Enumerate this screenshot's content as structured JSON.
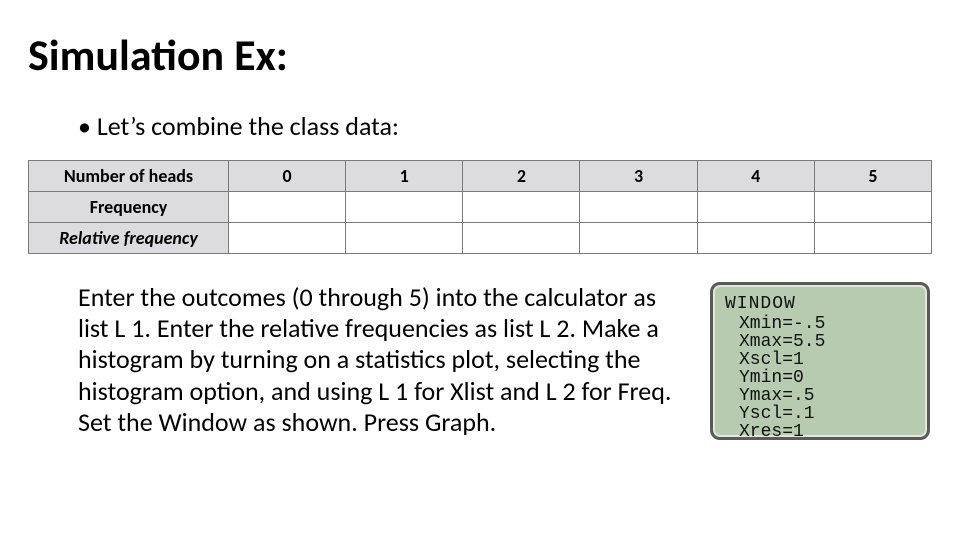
{
  "title": "Simulation Ex:",
  "bullet": "Let’s combine the class data:",
  "table": {
    "headers": [
      "Number of heads",
      "0",
      "1",
      "2",
      "3",
      "4",
      "5"
    ],
    "rows": [
      {
        "label": "Frequency",
        "italic": false,
        "cells": [
          "",
          "",
          "",
          "",
          "",
          ""
        ]
      },
      {
        "label": "Relative frequency",
        "italic": true,
        "cells": [
          "",
          "",
          "",
          "",
          "",
          ""
        ]
      }
    ]
  },
  "paragraph": "Enter the outcomes (0 through 5) into the calculator as list L 1. Enter the relative frequencies as list L 2. Make a histogram by turning on a statistics plot, selecting the histogram option, and using L 1 for Xlist and L 2 for Freq. Set the Window as shown. Press Graph.",
  "calculator": {
    "title": "WINDOW",
    "lines": [
      "Xmin=-.5",
      "Xmax=5.5",
      "Xscl=1",
      "Ymin=0",
      "Ymax=.5",
      "Yscl=.1",
      "Xres=1"
    ]
  }
}
